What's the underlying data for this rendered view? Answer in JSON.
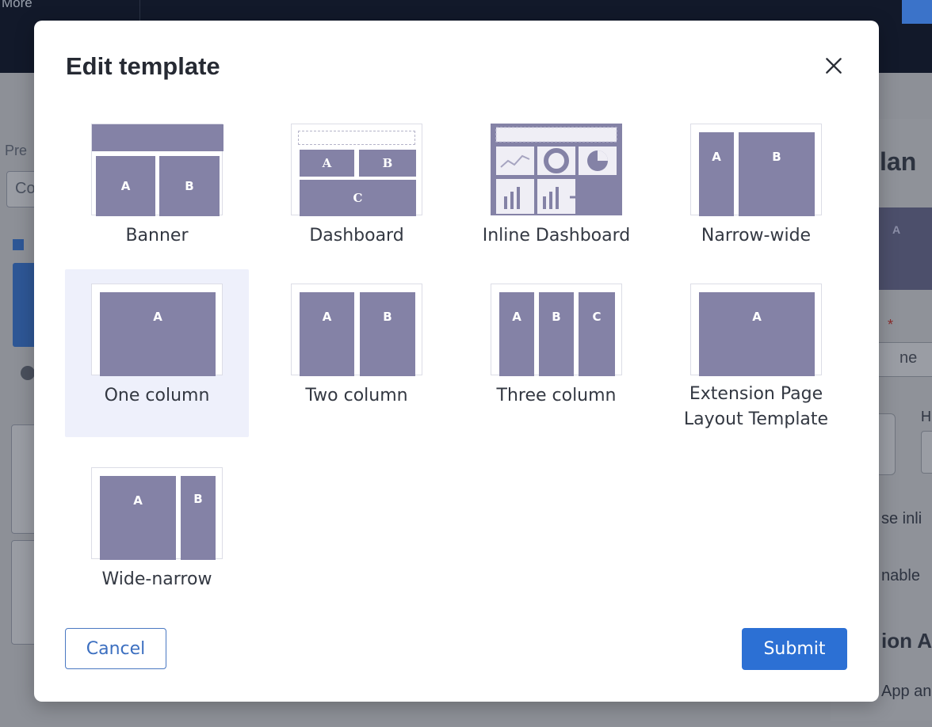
{
  "background": {
    "topbar_more": "More",
    "left_fragments": [
      "Pre",
      "Co"
    ],
    "right_fragments": [
      "lan",
      "A",
      "ne",
      "H",
      "se inli",
      "nable",
      "ion A",
      "App an"
    ]
  },
  "modal": {
    "title": "Edit template",
    "close_icon": "close-icon",
    "templates": [
      {
        "id": "banner",
        "label": "Banner",
        "blocks": [
          "A",
          "B"
        ]
      },
      {
        "id": "dashboard",
        "label": "Dashboard",
        "blocks": [
          "A",
          "B",
          "C"
        ]
      },
      {
        "id": "inline-dashboard",
        "label": "Inline Dashboard",
        "blocks": []
      },
      {
        "id": "narrow-wide",
        "label": "Narrow-wide",
        "blocks": [
          "A",
          "B"
        ]
      },
      {
        "id": "one-column",
        "label": "One column",
        "blocks": [
          "A"
        ],
        "selected": true
      },
      {
        "id": "two-column",
        "label": "Two column",
        "blocks": [
          "A",
          "B"
        ]
      },
      {
        "id": "three-column",
        "label": "Three column",
        "blocks": [
          "A",
          "B",
          "C"
        ]
      },
      {
        "id": "extension-page",
        "label_line1": "Extension Page",
        "label_line2": "Layout Template",
        "blocks": [
          "A"
        ]
      },
      {
        "id": "wide-narrow",
        "label": "Wide-narrow",
        "blocks": [
          "A",
          "B"
        ]
      }
    ],
    "cancel_label": "Cancel",
    "submit_label": "Submit"
  },
  "colors": {
    "block": "#8482a6",
    "selected_bg": "#eef0fb",
    "primary": "#2c70d4"
  }
}
